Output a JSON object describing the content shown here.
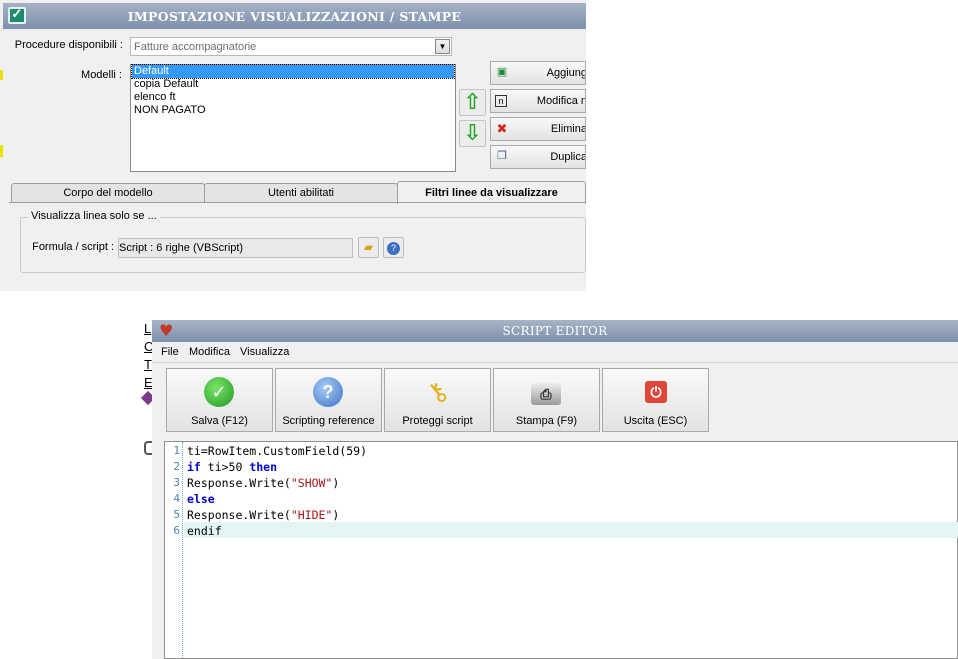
{
  "win1": {
    "title": "IMPOSTAZIONE VISUALIZZAZIONI / STAMPE",
    "procedure_label": "Procedure disponibili :",
    "procedure_value": "Fatture accompagnatorie",
    "modelli_label": "Modelli :",
    "modelli": [
      "Default",
      "copia Default",
      "elenco ft",
      "NON PAGATO"
    ],
    "buttons": {
      "add": "Aggiung",
      "edit": "Modifica n",
      "delete": "Elimina",
      "duplicate": "Duplica"
    },
    "tabs": [
      "Corpo del modello",
      "Utenti abilitati",
      "Filtri linee da visualizzare"
    ],
    "group_title": "Visualizza linea solo se ...",
    "formula_label": "Formula / script :",
    "formula_value": "Script : 6 righe (VBScript)"
  },
  "background_fragments": [
    "L",
    "O",
    "T",
    "E"
  ],
  "win2": {
    "title": "SCRIPT EDITOR",
    "menu": [
      "File",
      "Modifica",
      "Visualizza"
    ],
    "toolbar": [
      {
        "label": "Salva (F12)",
        "icon": "checkmark-icon"
      },
      {
        "label": "Scripting reference",
        "icon": "help-icon"
      },
      {
        "label": "Proteggi script",
        "icon": "key-icon"
      },
      {
        "label": "Stampa (F9)",
        "icon": "printer-icon"
      },
      {
        "label": "Uscita (ESC)",
        "icon": "exit-icon"
      }
    ],
    "code_lines": [
      {
        "n": "1",
        "text": "ti=RowItem.CustomField(59)"
      },
      {
        "n": "2",
        "text": "if ti>50 then"
      },
      {
        "n": "3",
        "text": "Response.Write(\"SHOW\")"
      },
      {
        "n": "4",
        "text": "else"
      },
      {
        "n": "5",
        "text": "Response.Write(\"HIDE\")"
      },
      {
        "n": "6",
        "text": "endif"
      }
    ]
  },
  "colors": {
    "titlebar": "#8b9bb4",
    "selection": "#3399ff",
    "keyword": "#0000cc",
    "string": "#a31515",
    "current_line": "#e4f4f4"
  }
}
